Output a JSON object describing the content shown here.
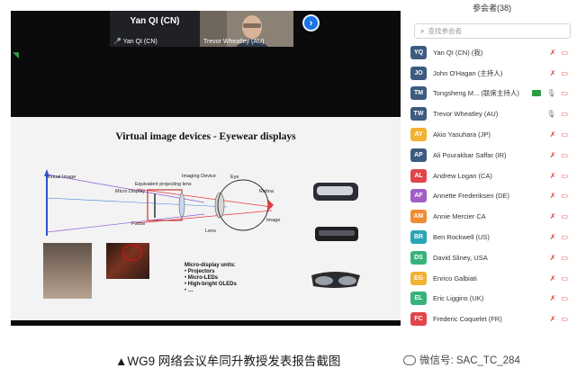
{
  "meeting": {
    "tiles": [
      {
        "name": "Yan QI (CN)",
        "label": "Yan QI (CN)",
        "mic": "muted"
      },
      {
        "label": "Trevor Wheatley (AU)"
      }
    ],
    "next_icon": "›",
    "side_mark": "◥"
  },
  "slide": {
    "title": "Virtual image devices - Eyewear displays",
    "labels": {
      "virtual_image": "Virtual Image",
      "micro_display": "Micro Display",
      "equiv_lens": "Equivalent projecting lens",
      "imaging_device": "Imaging Device",
      "eye": "Eye",
      "retina": "Retina",
      "focus": "Focus",
      "lens": "Lens",
      "image": "Image"
    },
    "micro_units": {
      "heading": "Micro-display units:",
      "items": [
        "Projectors",
        "Micro-LEDs",
        "High-bright OLEDs",
        "…"
      ]
    }
  },
  "sidebar": {
    "title": "参会者(38)",
    "search_placeholder": "查找参会者",
    "participants": [
      {
        "initials": "YQ",
        "name": "Yan QI (CN) (我)",
        "color": "#3d5a80",
        "mic": "off",
        "cam": "off"
      },
      {
        "initials": "JO",
        "name": "John O'Hagan (主持人)",
        "color": "#3d5a80",
        "mic": "off",
        "cam": "off"
      },
      {
        "initials": "TM",
        "name": "Tongsheng M... (联席主持人)",
        "color": "#3d5a80",
        "mic": "on",
        "cam": "off",
        "sharing": true
      },
      {
        "initials": "TW",
        "name": "Trevor Wheatley  (AU)",
        "color": "#3d5a80",
        "mic": "on",
        "cam": "off"
      },
      {
        "initials": "AY",
        "name": "Akio Yasuhara (JP)",
        "color": "#f2b233",
        "mic": "off",
        "cam": "off"
      },
      {
        "initials": "AP",
        "name": "Ali Pourakbar Saffar (IR)",
        "color": "#3d5a80",
        "mic": "off",
        "cam": "off"
      },
      {
        "initials": "AL",
        "name": "Andrew Logan (CA)",
        "color": "#e0454b",
        "mic": "off",
        "cam": "off"
      },
      {
        "initials": "AF",
        "name": "Annette Frederiksen (DE)",
        "color": "#a05fc6",
        "mic": "off",
        "cam": "off"
      },
      {
        "initials": "AM",
        "name": "Annie Mercier CA",
        "color": "#f28c33",
        "mic": "off",
        "cam": "off"
      },
      {
        "initials": "BR",
        "name": "Ben Rockwell (US)",
        "color": "#2aa5b8",
        "mic": "off",
        "cam": "off"
      },
      {
        "initials": "DS",
        "name": "David Sliney, USA",
        "color": "#38b37a",
        "mic": "off",
        "cam": "off"
      },
      {
        "initials": "EG",
        "name": "Enrico Galbiati",
        "color": "#f2b233",
        "mic": "off",
        "cam": "off"
      },
      {
        "initials": "EL",
        "name": "Eric Liggins (UK)",
        "color": "#38b37a",
        "mic": "off",
        "cam": "off"
      },
      {
        "initials": "FC",
        "name": "Frederic Coquelet (FR)",
        "color": "#e0454b",
        "mic": "off",
        "cam": "off"
      }
    ]
  },
  "caption": "▲WG9 网络会议牟同升教授发表报告截图",
  "watermark": "微信号: SAC_TC_284"
}
